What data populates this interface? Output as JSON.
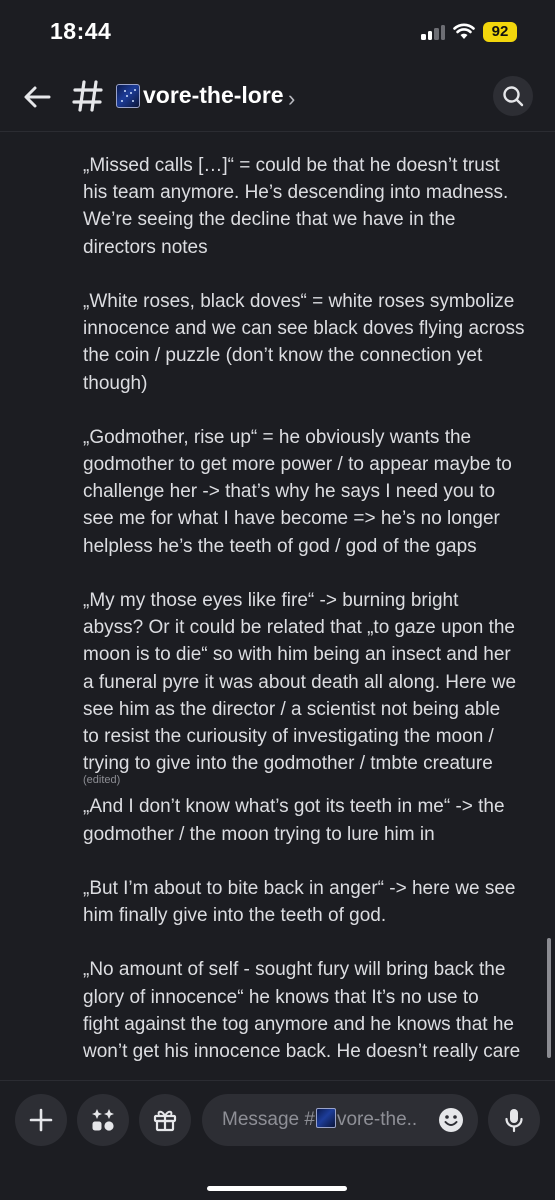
{
  "status_bar": {
    "time": "18:44",
    "battery": "92",
    "battery_color": "#f2d60c"
  },
  "header": {
    "channel_name": "vore-the-lore",
    "hash_icon": "hash-icon",
    "channel_emoji": "galaxy-emoji",
    "chevron": "›",
    "back_icon": "back-arrow-icon",
    "search_icon": "search-icon"
  },
  "messages": {
    "lines": [
      "„Missed calls […]“ = could be that he doesn’t trust",
      "his team anymore. He’s descending into madness.",
      "We’re seeing the decline that we have in the",
      "directors notes",
      "",
      "„White roses, black doves“ = white roses symbolize",
      "innocence and we can see black doves flying across",
      "the coin / puzzle (don’t know the connection yet",
      "though)",
      "",
      "„Godmother, rise up“ = he obviously wants the",
      "godmother to get more power / to appear maybe to",
      "challenge her -> that’s why he says I need you to",
      "see me for what I have become => he’s no longer",
      "helpless he’s the teeth of god / god of the gaps",
      "",
      "„My my those eyes like fire“ -> burning bright",
      "abyss? Or it could be related that „to gaze upon the",
      "moon is to die“ so with him being an insect and her",
      "a funeral pyre it was about death all along. Here we",
      "see him as the director / a scientist not being able",
      "to resist the curiousity of investigating the moon /",
      "trying to give into the godmother / tmbte creature"
    ],
    "edited_label": "(edited)",
    "lines_after": [
      "„And I don’t know what’s got its teeth in me“ -> the",
      "godmother / the moon trying to lure him in",
      "",
      "„But I’m about to bite back in anger“ -> here we see",
      "him finally give into the teeth of god.",
      "",
      "„No amount of self - sought fury will bring back the",
      "glory of innocence“ he knows that It’s no use to",
      "fight against the tog anymore and he knows that he",
      "won’t get his innocence back. He doesn’t really care"
    ]
  },
  "composer": {
    "placeholder_prefix": "Message #",
    "placeholder_suffix": "vore-the..",
    "icons": [
      "plus-icon",
      "apps-icon",
      "gift-icon",
      "emoji-icon",
      "microphone-icon"
    ]
  },
  "colors": {
    "background": "#1c1d22",
    "surface": "#2d2e34",
    "text": "#dcdde1",
    "muted": "#8e8f96"
  }
}
